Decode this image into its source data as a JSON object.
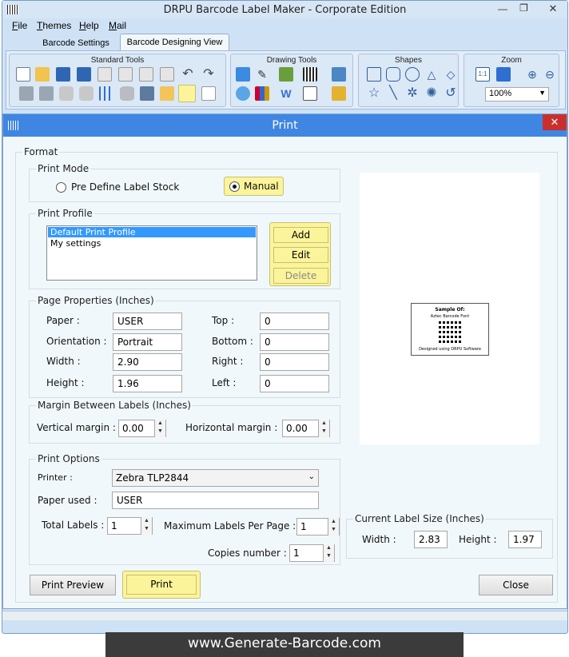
{
  "window": {
    "title": "DRPU Barcode Label Maker - Corporate Edition",
    "controls": [
      "—",
      "❐",
      "✕"
    ]
  },
  "menu": [
    {
      "label": "File",
      "underline": "F",
      "rest": "ile"
    },
    {
      "label": "Themes",
      "underline": "T",
      "rest": "hemes"
    },
    {
      "label": "Help",
      "underline": "H",
      "rest": "elp"
    },
    {
      "label": "Mail",
      "underline": "M",
      "rest": "ail"
    }
  ],
  "tabs": [
    {
      "label": "Barcode Settings",
      "active": false
    },
    {
      "label": "Barcode Designing View",
      "active": true
    }
  ],
  "ribbon": {
    "groups": [
      {
        "title": "Standard Tools"
      },
      {
        "title": "Drawing Tools"
      },
      {
        "title": "Shapes"
      },
      {
        "title": "Zoom"
      }
    ],
    "zoom_value": "100%"
  },
  "dialog": {
    "title": "Print",
    "close": "✕",
    "format_legend": "Format",
    "print_mode": {
      "legend": "Print Mode",
      "option_predefined": "Pre Define Label Stock",
      "option_manual": "Manual",
      "selected": "Manual"
    },
    "print_profile": {
      "legend": "Print Profile",
      "items": [
        "Default Print Profile",
        "My settings"
      ],
      "selected": "Default Print Profile",
      "add": "Add",
      "edit": "Edit",
      "delete": "Delete"
    },
    "page_properties": {
      "legend": "Page Properties (Inches)",
      "paper_label": "Paper :",
      "paper_value": "USER",
      "orientation_label": "Orientation :",
      "orientation_value": "Portrait",
      "width_label": "Width :",
      "width_value": "2.90",
      "height_label": "Height :",
      "height_value": "1.96",
      "top_label": "Top :",
      "top_value": "0",
      "bottom_label": "Bottom :",
      "bottom_value": "0",
      "right_label": "Right :",
      "right_value": "0",
      "left_label": "Left :",
      "left_value": "0"
    },
    "margin": {
      "legend": "Margin Between Labels (Inches)",
      "vertical_label": "Vertical margin :",
      "vertical_value": "0.00",
      "horizontal_label": "Horizontal margin :",
      "horizontal_value": "0.00"
    },
    "print_options": {
      "legend": "Print Options",
      "printer_label": "Printer :",
      "printer_value": "Zebra TLP2844",
      "paper_used_label": "Paper used :",
      "paper_used_value": "USER",
      "total_labels_label": "Total Labels :",
      "total_labels_value": "1",
      "max_per_page_label": "Maximum Labels Per Page :",
      "max_per_page_value": "1",
      "copies_label": "Copies number :",
      "copies_value": "1"
    },
    "preview": {
      "line1": "Sample Of:",
      "line2": "Aztec Barcode Font",
      "line3": "Designed using DRPU Software"
    },
    "current_label_size": {
      "legend": "Current Label Size (Inches)",
      "width_label": "Width :",
      "width_value": "2.83",
      "height_label": "Height :",
      "height_value": "1.97"
    },
    "buttons": {
      "print_preview": "Print Preview",
      "print": "Print",
      "close": "Close"
    }
  },
  "footer": {
    "text": "www.Generate-Barcode.com"
  },
  "colors": {
    "dialog_title_bar": "#3f86e2",
    "highlight_button": "#fbf49a",
    "selection": "#3399ff",
    "close_button": "#c9302c"
  }
}
